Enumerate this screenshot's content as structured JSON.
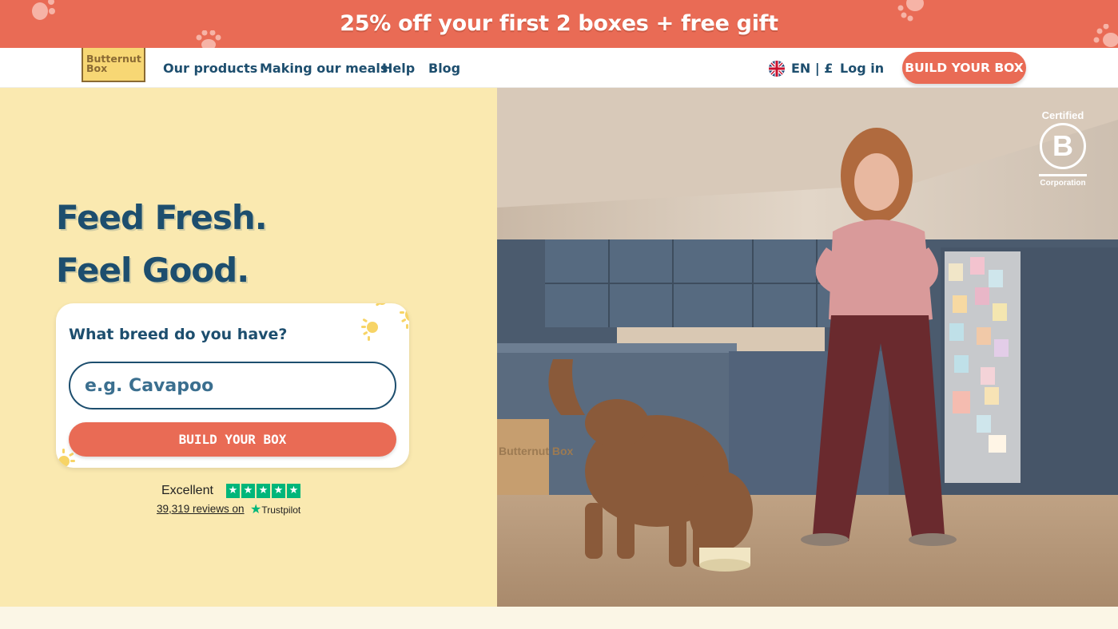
{
  "promo": {
    "text": "25% off your first 2 boxes + free gift"
  },
  "nav": {
    "logo_line1": "Butternut",
    "logo_line2": "Box",
    "links": [
      "Our products",
      "Making our meals",
      "Help",
      "Blog"
    ],
    "locale": "EN | £",
    "login": "Log in",
    "cta": "BUILD YOUR BOX"
  },
  "hero": {
    "title_line1": "Feed Fresh.",
    "title_line2": "Feel Good.",
    "breed_label": "What breed do you have?",
    "breed_placeholder": "e.g. Cavapoo",
    "cta": "BUILD YOUR BOX"
  },
  "trustpilot": {
    "rating_text": "Excellent",
    "stars": 5,
    "reviews": "39,319 reviews on",
    "brand": "Trustpilot"
  },
  "badge": {
    "top": "Certified",
    "letter": "B",
    "bottom": "Corporation"
  },
  "box_print": "Butternut Box",
  "colors": {
    "accent": "#e96b55",
    "navy": "#1d4e6e",
    "hero_bg": "#fae9b0",
    "trustpilot_green": "#00b67a"
  }
}
